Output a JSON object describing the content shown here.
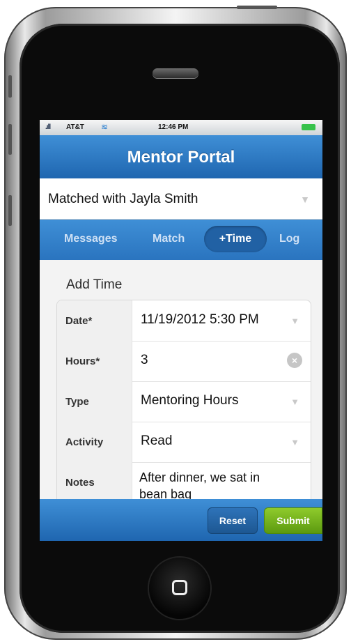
{
  "status_bar": {
    "carrier": "AT&T",
    "time": "12:46 PM",
    "battery_color": "#37c24a"
  },
  "header": {
    "title": "Mentor Portal"
  },
  "match_select": {
    "value": "Matched with Jayla Smith"
  },
  "tabs": [
    {
      "label": "Messages",
      "active": false
    },
    {
      "label": "Match",
      "active": false
    },
    {
      "label": "+Time",
      "active": true
    },
    {
      "label": "Log",
      "active": false
    }
  ],
  "form": {
    "heading": "Add Time",
    "rows": [
      {
        "label": "Date*",
        "value": "11/19/2012 5:30 PM",
        "control": "dropdown"
      },
      {
        "label": "Hours*",
        "value": "3",
        "control": "text-clearable"
      },
      {
        "label": "Type",
        "value": "Mentoring Hours",
        "control": "dropdown"
      },
      {
        "label": "Activity",
        "value": "Read",
        "control": "dropdown"
      },
      {
        "label": "Notes",
        "value": "After dinner, we sat in bean bag",
        "control": "textarea"
      }
    ]
  },
  "footer": {
    "reset_label": "Reset",
    "submit_label": "Submit"
  },
  "colors": {
    "header_blue": "#2a74bf",
    "submit_green": "#6fae18",
    "reset_blue": "#1d5792"
  }
}
